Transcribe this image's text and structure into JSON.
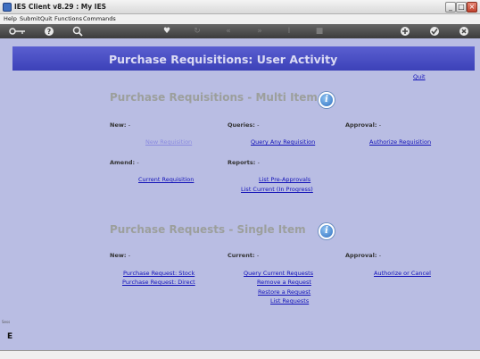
{
  "window": {
    "title": "IES Client v8.29 : My IES",
    "minimize": "_",
    "maximize": "□",
    "close": "×"
  },
  "menu": [
    "Help",
    "Submit",
    "Quit",
    "Functions",
    "Commands"
  ],
  "toolbar": {
    "icons": [
      "key-icon",
      "help-icon",
      "search-icon",
      "heart-icon",
      "refresh-icon",
      "rewind-icon",
      "forward-icon",
      "text-cursor-icon",
      "stop-icon",
      "add-icon",
      "check-icon",
      "close-icon"
    ]
  },
  "header": {
    "title": "Purchase Requisitions: User Activity",
    "quit": "Quit"
  },
  "multi": {
    "title": "Purchase Requisitions - Multi Item",
    "new_label": "New:",
    "queries_label": "Queries:",
    "approval_label": "Approval:",
    "amend_label": "Amend:",
    "reports_label": "Reports:",
    "new_requisition": "New Requisition",
    "query_any": "Query Any Requisition",
    "authorize": "Authorize Requisition",
    "current_requisition": "Current Requisition",
    "list_pre": "List Pre-Approvals",
    "list_current": "List Current (In Progress)"
  },
  "single": {
    "title": "Purchase Requests - Single Item",
    "new_label": "New:",
    "current_label": "Current:",
    "approval_label": "Approval:",
    "request_stock": "Purchase Request: Stock",
    "request_direct": "Purchase Request: Direct",
    "query_current": "Query Current Requests",
    "remove": "Remove a Request",
    "restore": "Restore a Request",
    "list": "List Requests",
    "authorize_cancel": "Authorize or Cancel"
  },
  "dash": "-",
  "info_glyph": "i",
  "leftstrip": {
    "small": "Sess",
    "letter": "E"
  }
}
